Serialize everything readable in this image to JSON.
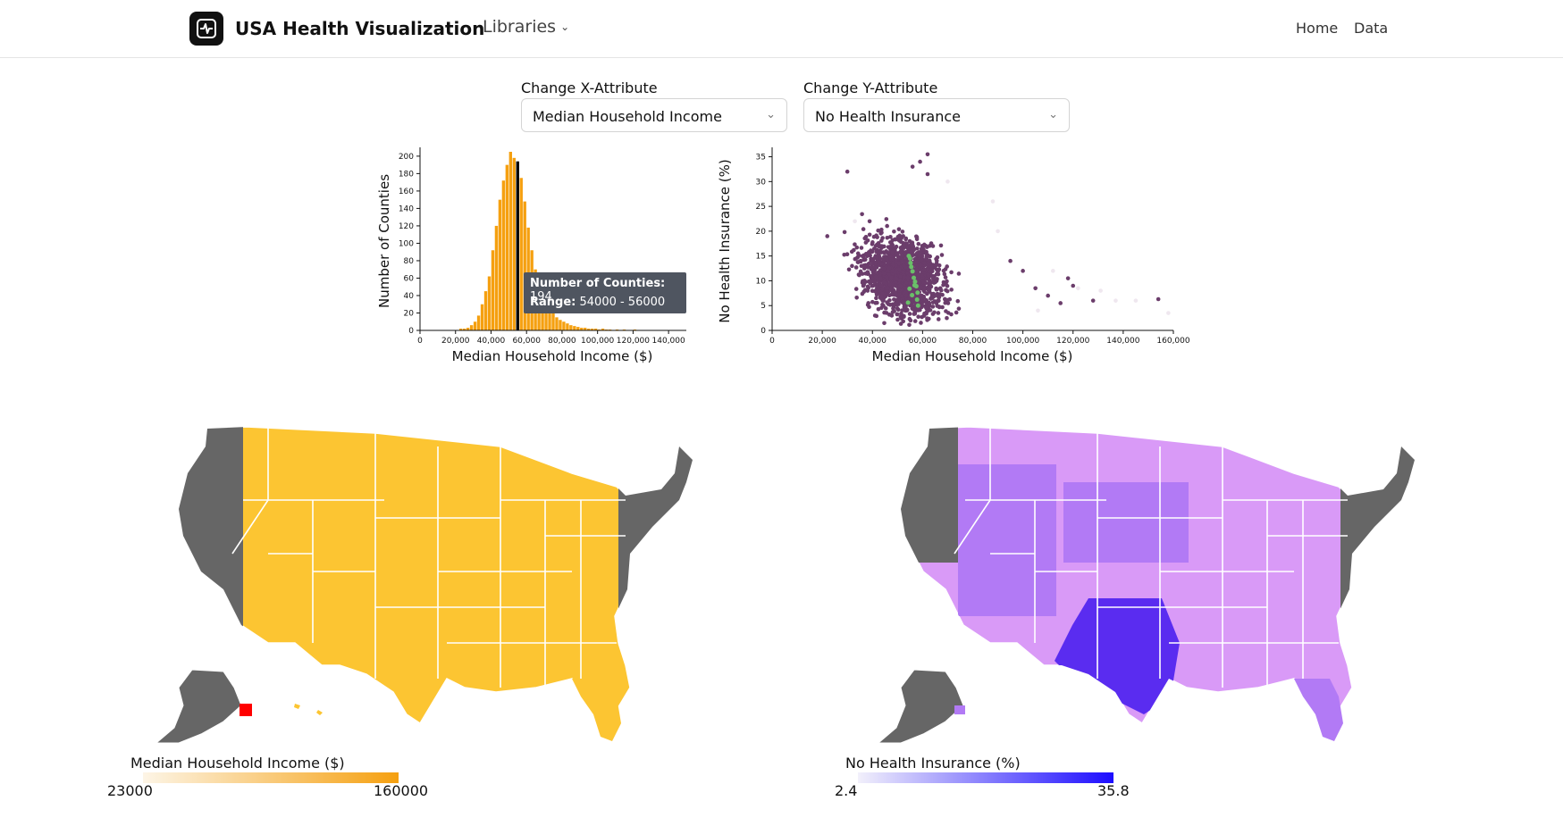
{
  "app": {
    "title": "USA Health Visualization",
    "libraries_label": "Libraries"
  },
  "nav": {
    "home": "Home",
    "data": "Data"
  },
  "controls": {
    "x_label": "Change X-Attribute",
    "x_value": "Median Household Income",
    "y_label": "Change Y-Attribute",
    "y_value": "No Health Insurance"
  },
  "tooltip": {
    "count_label": "Number of Counties:",
    "count_value": "194",
    "range_label": "Range:",
    "range_value": "54000 - 56000"
  },
  "chart_data": [
    {
      "type": "bar",
      "xlabel": "Median Household Income ($)",
      "ylabel": "Number of Counties",
      "xlim": [
        0,
        150000
      ],
      "ylim": [
        0,
        205
      ],
      "x_ticks": [
        "0",
        "20,000",
        "40,000",
        "60,000",
        "80,000",
        "100,000",
        "120,000",
        "140,000"
      ],
      "y_ticks": [
        "0",
        "20",
        "40",
        "60",
        "80",
        "100",
        "120",
        "140",
        "160",
        "180",
        "200"
      ],
      "bin_width": 2000,
      "bins_start": [
        22000,
        24000,
        26000,
        28000,
        30000,
        32000,
        34000,
        36000,
        38000,
        40000,
        42000,
        44000,
        46000,
        48000,
        50000,
        52000,
        54000,
        56000,
        58000,
        60000,
        62000,
        64000,
        66000,
        68000,
        70000,
        72000,
        74000,
        76000,
        78000,
        80000,
        82000,
        84000,
        86000,
        88000,
        90000,
        92000,
        94000,
        96000,
        98000,
        100000,
        102000,
        104000,
        106000,
        108000,
        110000,
        112000,
        114000,
        116000,
        118000,
        120000
      ],
      "values": [
        2,
        2,
        3,
        6,
        10,
        17,
        30,
        45,
        62,
        92,
        120,
        150,
        172,
        190,
        205,
        198,
        194,
        175,
        148,
        118,
        92,
        70,
        55,
        42,
        33,
        24,
        20,
        15,
        12,
        10,
        8,
        6,
        5,
        4,
        3,
        3,
        2,
        2,
        2,
        1,
        2,
        1,
        1,
        0,
        1,
        0,
        1,
        0,
        0,
        1
      ],
      "highlighted_bin": 54000,
      "colors": {
        "bar": "#f5a010",
        "highlight": "#000000"
      }
    },
    {
      "type": "scatter",
      "xlabel": "Median Household Income ($)",
      "ylabel": "No Health Insurance (%)",
      "xlim": [
        0,
        160000
      ],
      "ylim": [
        0,
        36
      ],
      "x_ticks": [
        "0",
        "20,000",
        "40,000",
        "60,000",
        "80,000",
        "100,000",
        "120,000",
        "140,000",
        "160,000"
      ],
      "y_ticks": [
        "0",
        "5",
        "10",
        "15",
        "20",
        "25",
        "30",
        "35"
      ],
      "colors": {
        "point": "#6b3d6b",
        "highlight": "#6abf69",
        "faded": "#efe7ef"
      },
      "highlighted_points": [
        {
          "x": 54500,
          "y": 15.0
        },
        {
          "x": 55000,
          "y": 14.5
        },
        {
          "x": 55500,
          "y": 12.8
        },
        {
          "x": 56000,
          "y": 11.9
        },
        {
          "x": 56500,
          "y": 10.6
        },
        {
          "x": 57000,
          "y": 9.8
        },
        {
          "x": 57500,
          "y": 8.9
        },
        {
          "x": 58000,
          "y": 7.6
        },
        {
          "x": 55200,
          "y": 13.6
        },
        {
          "x": 56800,
          "y": 9.1
        },
        {
          "x": 54800,
          "y": 8.4
        },
        {
          "x": 57800,
          "y": 6.2
        },
        {
          "x": 55800,
          "y": 7.1
        },
        {
          "x": 54200,
          "y": 5.6
        },
        {
          "x": 58200,
          "y": 5.0
        }
      ],
      "outliers": [
        {
          "x": 62000,
          "y": 35.5
        },
        {
          "x": 59000,
          "y": 34.0
        },
        {
          "x": 62000,
          "y": 31.5
        },
        {
          "x": 56000,
          "y": 33.0
        },
        {
          "x": 30000,
          "y": 32.0
        },
        {
          "x": 22000,
          "y": 19.0
        },
        {
          "x": 118000,
          "y": 10.5
        },
        {
          "x": 120000,
          "y": 9.0
        },
        {
          "x": 110000,
          "y": 7.0
        },
        {
          "x": 115000,
          "y": 5.5
        },
        {
          "x": 128000,
          "y": 6.0
        },
        {
          "x": 154000,
          "y": 6.3
        },
        {
          "x": 100000,
          "y": 12.0
        },
        {
          "x": 95000,
          "y": 14.0
        },
        {
          "x": 105000,
          "y": 8.5
        }
      ],
      "faded_points": [
        {
          "x": 131000,
          "y": 8.0
        },
        {
          "x": 137000,
          "y": 6.0
        },
        {
          "x": 145000,
          "y": 6.0
        },
        {
          "x": 158000,
          "y": 3.5
        },
        {
          "x": 112000,
          "y": 12.0
        },
        {
          "x": 90000,
          "y": 20.0
        },
        {
          "x": 88000,
          "y": 26.0
        },
        {
          "x": 70000,
          "y": 30.0
        },
        {
          "x": 33000,
          "y": 22.0
        },
        {
          "x": 122000,
          "y": 8.5
        },
        {
          "x": 106000,
          "y": 4.0
        }
      ]
    }
  ],
  "maps": [
    {
      "legend_title": "Median Household Income ($)",
      "legend_min": "23000",
      "legend_max": "160000",
      "gradient": [
        "#fdf5e6",
        "#f5a010"
      ],
      "fill": "#fcc532",
      "grey": "#666666",
      "highlight": "#ff0000"
    },
    {
      "legend_title": "No Health Insurance (%)",
      "legend_min": "2.4",
      "legend_max": "35.8",
      "gradient": [
        "#f2f0fb",
        "#1c0cff"
      ],
      "fill": "#d99af7",
      "mid": "#b27af5",
      "dark": "#5a2cf0",
      "grey": "#666666"
    }
  ]
}
